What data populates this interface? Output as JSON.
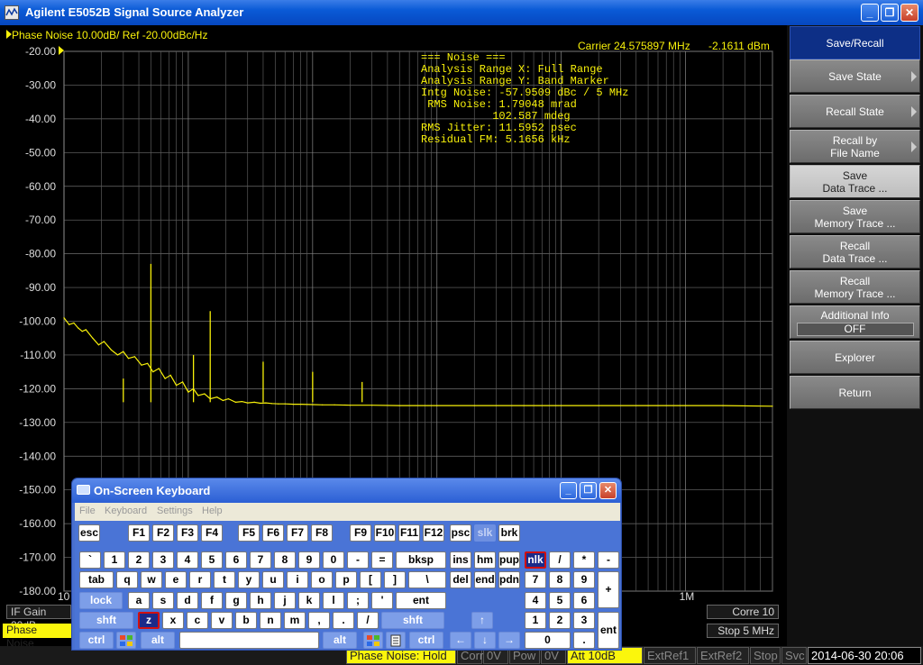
{
  "window": {
    "title": "Agilent E5052B Signal Source Analyzer",
    "minimize": "_",
    "restore": "❐",
    "close": "✕"
  },
  "header": {
    "trace": "Phase Noise 10.00dB/ Ref -20.00dBc/Hz",
    "carrier": "Carrier 24.575897 MHz",
    "power": "-2.1611 dBm"
  },
  "noise": {
    "lines": [
      "=== Noise ===",
      "Analysis Range X: Full Range",
      "Analysis Range Y: Band Marker",
      "Intg Noise: -57.9509 dBc / 5 MHz",
      " RMS Noise: 1.79048 mrad",
      "           102.587 mdeg",
      "RMS Jitter: 11.5952 psec",
      "Residual FM: 5.1656 kHz"
    ]
  },
  "chart_data": {
    "type": "line",
    "title": "",
    "ylim": [
      -180,
      -20
    ],
    "yticks": [
      "-20.00",
      "-30.00",
      "-40.00",
      "-50.00",
      "-60.00",
      "-70.00",
      "-80.00",
      "-90.00",
      "-100.00",
      "-110.00",
      "-120.00",
      "-130.00",
      "-140.00",
      "-150.00",
      "-160.00",
      "-170.00",
      "-180.00"
    ],
    "x_scale": "log",
    "xlim_hz": [
      10,
      5000000
    ],
    "xtick_labels": [
      {
        "hz": 10,
        "text": "10"
      },
      {
        "hz": 1000000,
        "text": "1M"
      }
    ],
    "grid": true,
    "color": "#f8f10a",
    "series": [
      {
        "x": [
          10,
          11,
          12,
          13,
          14,
          15,
          17,
          19,
          21,
          24,
          27,
          30,
          33,
          37,
          42,
          47,
          52,
          58,
          65,
          72,
          80,
          90,
          100,
          110,
          120,
          135,
          150,
          170,
          190,
          210,
          240,
          270,
          300,
          340,
          380,
          420,
          470,
          530,
          600,
          700,
          800,
          1000,
          1200,
          1500,
          2000,
          3000,
          5000,
          10000,
          20000,
          50000,
          100000,
          200000,
          500000,
          1000000,
          2000000,
          5000000
        ],
        "y": [
          -99,
          -101,
          -100.5,
          -102,
          -103,
          -102.5,
          -105,
          -107,
          -106,
          -108.5,
          -110,
          -109,
          -111,
          -110.5,
          -113,
          -112.5,
          -115,
          -114,
          -117,
          -116,
          -119,
          -118,
          -121,
          -120,
          -122,
          -121.5,
          -123,
          -122.5,
          -123.5,
          -123,
          -124,
          -123.8,
          -124.2,
          -124,
          -124.3,
          -124.2,
          -124.4,
          -124.5,
          -124.5,
          -124.6,
          -124.6,
          -124.7,
          -124.8,
          -124.8,
          -124.9,
          -124.9,
          -125,
          -125,
          -125,
          -125,
          -125,
          -125,
          -125,
          -125,
          -125,
          -125.2
        ]
      }
    ],
    "spurs": [
      {
        "x": 50,
        "y": -83
      },
      {
        "x": 150,
        "y": -97
      },
      {
        "x": 400,
        "y": -112
      },
      {
        "x": 1000,
        "y": -115
      },
      {
        "x": 2500,
        "y": -118
      },
      {
        "x": 110,
        "y": -110
      },
      {
        "x": 30,
        "y": -117
      }
    ]
  },
  "side_tags": {
    "ifgain": "IF Gain 20dB",
    "phase_noise": "Phase Noise",
    "corre": "Corre 10",
    "stop": "Stop 5 MHz"
  },
  "softkeys": [
    {
      "label": "Save/Recall",
      "style": "head"
    },
    {
      "label": "Save State",
      "arrow": true
    },
    {
      "label": "Recall State",
      "arrow": true
    },
    {
      "label": "Recall by",
      "label2": "File Name",
      "arrow": true
    },
    {
      "label": "Save",
      "label2": "Data Trace ...",
      "style": "sel"
    },
    {
      "label": "Save",
      "label2": "Memory Trace ..."
    },
    {
      "label": "Recall",
      "label2": "Data Trace ..."
    },
    {
      "label": "Recall",
      "label2": "Memory Trace ..."
    },
    {
      "label": "Additional Info",
      "value": "OFF"
    },
    {
      "label": "Explorer"
    },
    {
      "label": "Return"
    }
  ],
  "statusbar": {
    "items": [
      "Phase Noise: Hold",
      "Corr",
      "0V",
      "Pow",
      "0V",
      "Att 10dB",
      "ExtRef1",
      "ExtRef2",
      "Stop",
      "Svc"
    ],
    "date": "2014-06-30 20:06"
  },
  "osk": {
    "title": "On-Screen Keyboard",
    "menu": [
      "File",
      "Keyboard",
      "Settings",
      "Help"
    ],
    "rows": {
      "r1": [
        "esc",
        "F1",
        "F2",
        "F3",
        "F4",
        "F5",
        "F6",
        "F7",
        "F8",
        "F9",
        "F10",
        "F11",
        "F12",
        "psc",
        "slk",
        "brk"
      ],
      "r2": [
        "`",
        "1",
        "2",
        "3",
        "4",
        "5",
        "6",
        "7",
        "8",
        "9",
        "0",
        "-",
        "=",
        "bksp",
        "ins",
        "hm",
        "pup",
        "nlk",
        "/",
        "*",
        "-"
      ],
      "r3": [
        "tab",
        "q",
        "w",
        "e",
        "r",
        "t",
        "y",
        "u",
        "i",
        "o",
        "p",
        "[",
        "]",
        "\\",
        "del",
        "end",
        "pdn",
        "7",
        "8",
        "9",
        "+"
      ],
      "r4": [
        "lock",
        "a",
        "s",
        "d",
        "f",
        "g",
        "h",
        "j",
        "k",
        "l",
        ";",
        "'",
        "ent",
        "4",
        "5",
        "6"
      ],
      "r5": [
        "shft",
        "z",
        "x",
        "c",
        "v",
        "b",
        "n",
        "m",
        ",",
        ".",
        "/",
        "shft",
        "↑",
        "1",
        "2",
        "3",
        "ent"
      ],
      "r6": [
        "ctrl",
        "alt",
        "alt",
        "ctrl",
        "←",
        "↓",
        "→",
        "0",
        "."
      ]
    }
  }
}
